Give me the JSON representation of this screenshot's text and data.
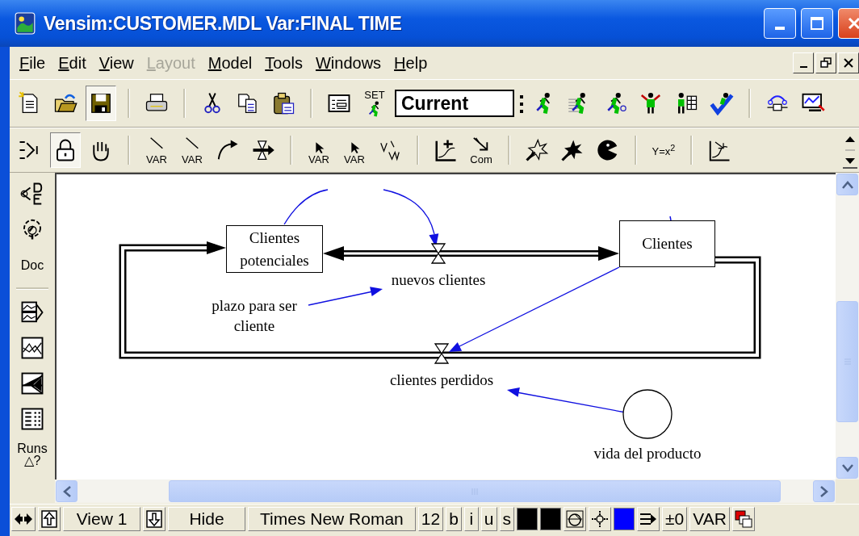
{
  "window": {
    "title": "Vensim:CUSTOMER.MDL Var:FINAL TIME"
  },
  "menu": [
    {
      "label": "File",
      "disabled": false
    },
    {
      "label": "Edit",
      "disabled": false
    },
    {
      "label": "View",
      "disabled": false
    },
    {
      "label": "Layout",
      "disabled": true
    },
    {
      "label": "Model",
      "disabled": false
    },
    {
      "label": "Tools",
      "disabled": false
    },
    {
      "label": "Windows",
      "disabled": false
    },
    {
      "label": "Help",
      "disabled": false
    }
  ],
  "toolbar_main": [
    {
      "kind": "button",
      "pressed": false
    },
    {
      "kind": "button",
      "pressed": false
    },
    {
      "kind": "button",
      "pressed": true
    },
    {
      "kind": "separator"
    },
    {
      "kind": "button",
      "pressed": false
    },
    {
      "kind": "separator"
    },
    {
      "kind": "button",
      "pressed": false
    },
    {
      "kind": "button",
      "pressed": false
    },
    {
      "kind": "button",
      "pressed": false
    },
    {
      "kind": "separator"
    },
    {
      "kind": "button",
      "pressed": false
    },
    {
      "kind": "button",
      "label": "SET",
      "pressed": false
    },
    {
      "kind": "field",
      "value": "Current"
    },
    {
      "kind": "grip"
    },
    {
      "kind": "button",
      "pressed": false
    },
    {
      "kind": "button",
      "pressed": false
    },
    {
      "kind": "button",
      "pressed": false
    },
    {
      "kind": "button",
      "pressed": false
    },
    {
      "kind": "button",
      "pressed": false
    },
    {
      "kind": "button",
      "pressed": false
    },
    {
      "kind": "separator"
    },
    {
      "kind": "button",
      "pressed": false
    },
    {
      "kind": "button",
      "pressed": false
    }
  ],
  "toolbar_sketch": [
    {
      "kind": "button",
      "pressed": false
    },
    {
      "kind": "button",
      "pressed": true
    },
    {
      "kind": "button",
      "pressed": false
    },
    {
      "kind": "separator"
    },
    {
      "kind": "button",
      "label": "VAR",
      "pressed": false
    },
    {
      "kind": "button",
      "label": "VAR",
      "pressed": false
    },
    {
      "kind": "button",
      "pressed": false
    },
    {
      "kind": "button",
      "pressed": false
    },
    {
      "kind": "separator"
    },
    {
      "kind": "button",
      "label": "VAR",
      "pressed": false
    },
    {
      "kind": "button",
      "label": "VAR",
      "pressed": false
    },
    {
      "kind": "button",
      "pressed": false
    },
    {
      "kind": "separator"
    },
    {
      "kind": "button",
      "pressed": false
    },
    {
      "kind": "button",
      "label": "Com",
      "pressed": false
    },
    {
      "kind": "separator"
    },
    {
      "kind": "button",
      "pressed": false
    },
    {
      "kind": "button",
      "pressed": false
    },
    {
      "kind": "button",
      "pressed": false
    },
    {
      "kind": "separator"
    },
    {
      "kind": "button",
      "label": "Y=x$^{2}$",
      "pressed": false
    },
    {
      "kind": "separator"
    },
    {
      "kind": "button",
      "pressed": false
    }
  ],
  "tool_column": [
    {
      "kind": "button"
    },
    {
      "kind": "button"
    },
    {
      "kind": "button",
      "label": "Doc"
    },
    {
      "kind": "separator"
    },
    {
      "kind": "button"
    },
    {
      "kind": "button"
    },
    {
      "kind": "button"
    },
    {
      "kind": "button"
    },
    {
      "kind": "button",
      "label": "Runs △?"
    }
  ],
  "diagram": {
    "stocks": [
      {
        "label": "Clientes potenciales"
      },
      {
        "label": "Clientes"
      }
    ],
    "flows": [
      {
        "label": "nuevos clientes"
      },
      {
        "label": "clientes perdidos"
      }
    ],
    "auxiliaries": [
      {
        "label": "plazo para ser cliente"
      }
    ],
    "constants": [
      {
        "label": "vida del producto"
      }
    ]
  },
  "status_bar": [
    {
      "kind": "nav"
    },
    {
      "kind": "icon"
    },
    {
      "kind": "button",
      "label": "View 1"
    },
    {
      "kind": "icon"
    },
    {
      "kind": "button",
      "label": "Hide"
    },
    {
      "kind": "button",
      "label": "Times New Roman"
    },
    {
      "kind": "button",
      "label": "12"
    },
    {
      "kind": "button",
      "label": "b"
    },
    {
      "kind": "button",
      "label": "i"
    },
    {
      "kind": "button",
      "label": "u"
    },
    {
      "kind": "button",
      "label": "s"
    },
    {
      "kind": "swatch",
      "color": "#000000"
    },
    {
      "kind": "swatch",
      "color": "#000000"
    },
    {
      "kind": "icon"
    },
    {
      "kind": "icon"
    },
    {
      "kind": "swatch",
      "color": "#0000ff"
    },
    {
      "kind": "icon"
    },
    {
      "kind": "button",
      "label": "±0"
    },
    {
      "kind": "button",
      "label": "VAR"
    },
    {
      "kind": "icon"
    }
  ]
}
